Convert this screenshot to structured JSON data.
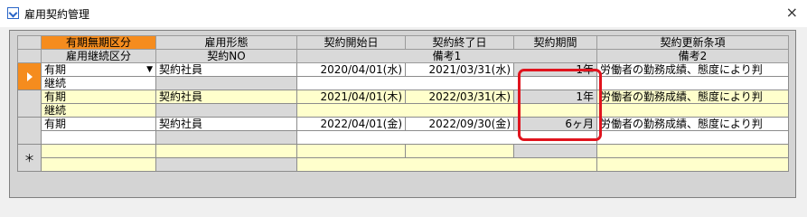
{
  "window": {
    "title": "雇用契約管理",
    "close": "×"
  },
  "header": {
    "row1": [
      "有期無期区分",
      "雇用形態",
      "契約開始日",
      "契約終了日",
      "契約期間",
      "契約更新条項"
    ],
    "row2": [
      "雇用継続区分",
      "契約NO",
      "備考1",
      "備考2"
    ]
  },
  "records": [
    {
      "kubun": "有期",
      "keitai": "契約社員",
      "start": "2020/04/01(水)",
      "end": "2021/03/31(水)",
      "period": "1年",
      "renewal": "労働者の勤務成績、態度により判",
      "keizoku": "継続",
      "no": "",
      "biko1": "",
      "biko2": ""
    },
    {
      "kubun": "有期",
      "keitai": "契約社員",
      "start": "2021/04/01(木)",
      "end": "2022/03/31(木)",
      "period": "1年",
      "renewal": "労働者の勤務成績、態度により判",
      "keizoku": "継続",
      "no": "",
      "biko1": "",
      "biko2": ""
    },
    {
      "kubun": "有期",
      "keitai": "契約社員",
      "start": "2022/04/01(金)",
      "end": "2022/09/30(金)",
      "period": "6ヶ月",
      "renewal": "労働者の勤務成績、態度により判",
      "keizoku": "",
      "no": "",
      "biko1": "",
      "biko2": ""
    }
  ],
  "new_row_marker": "＊",
  "dropdown_glyph": "▼",
  "colors": {
    "orange": "#f58c1e",
    "yellow": "#ffffcc",
    "highlight": "#e0141e"
  }
}
